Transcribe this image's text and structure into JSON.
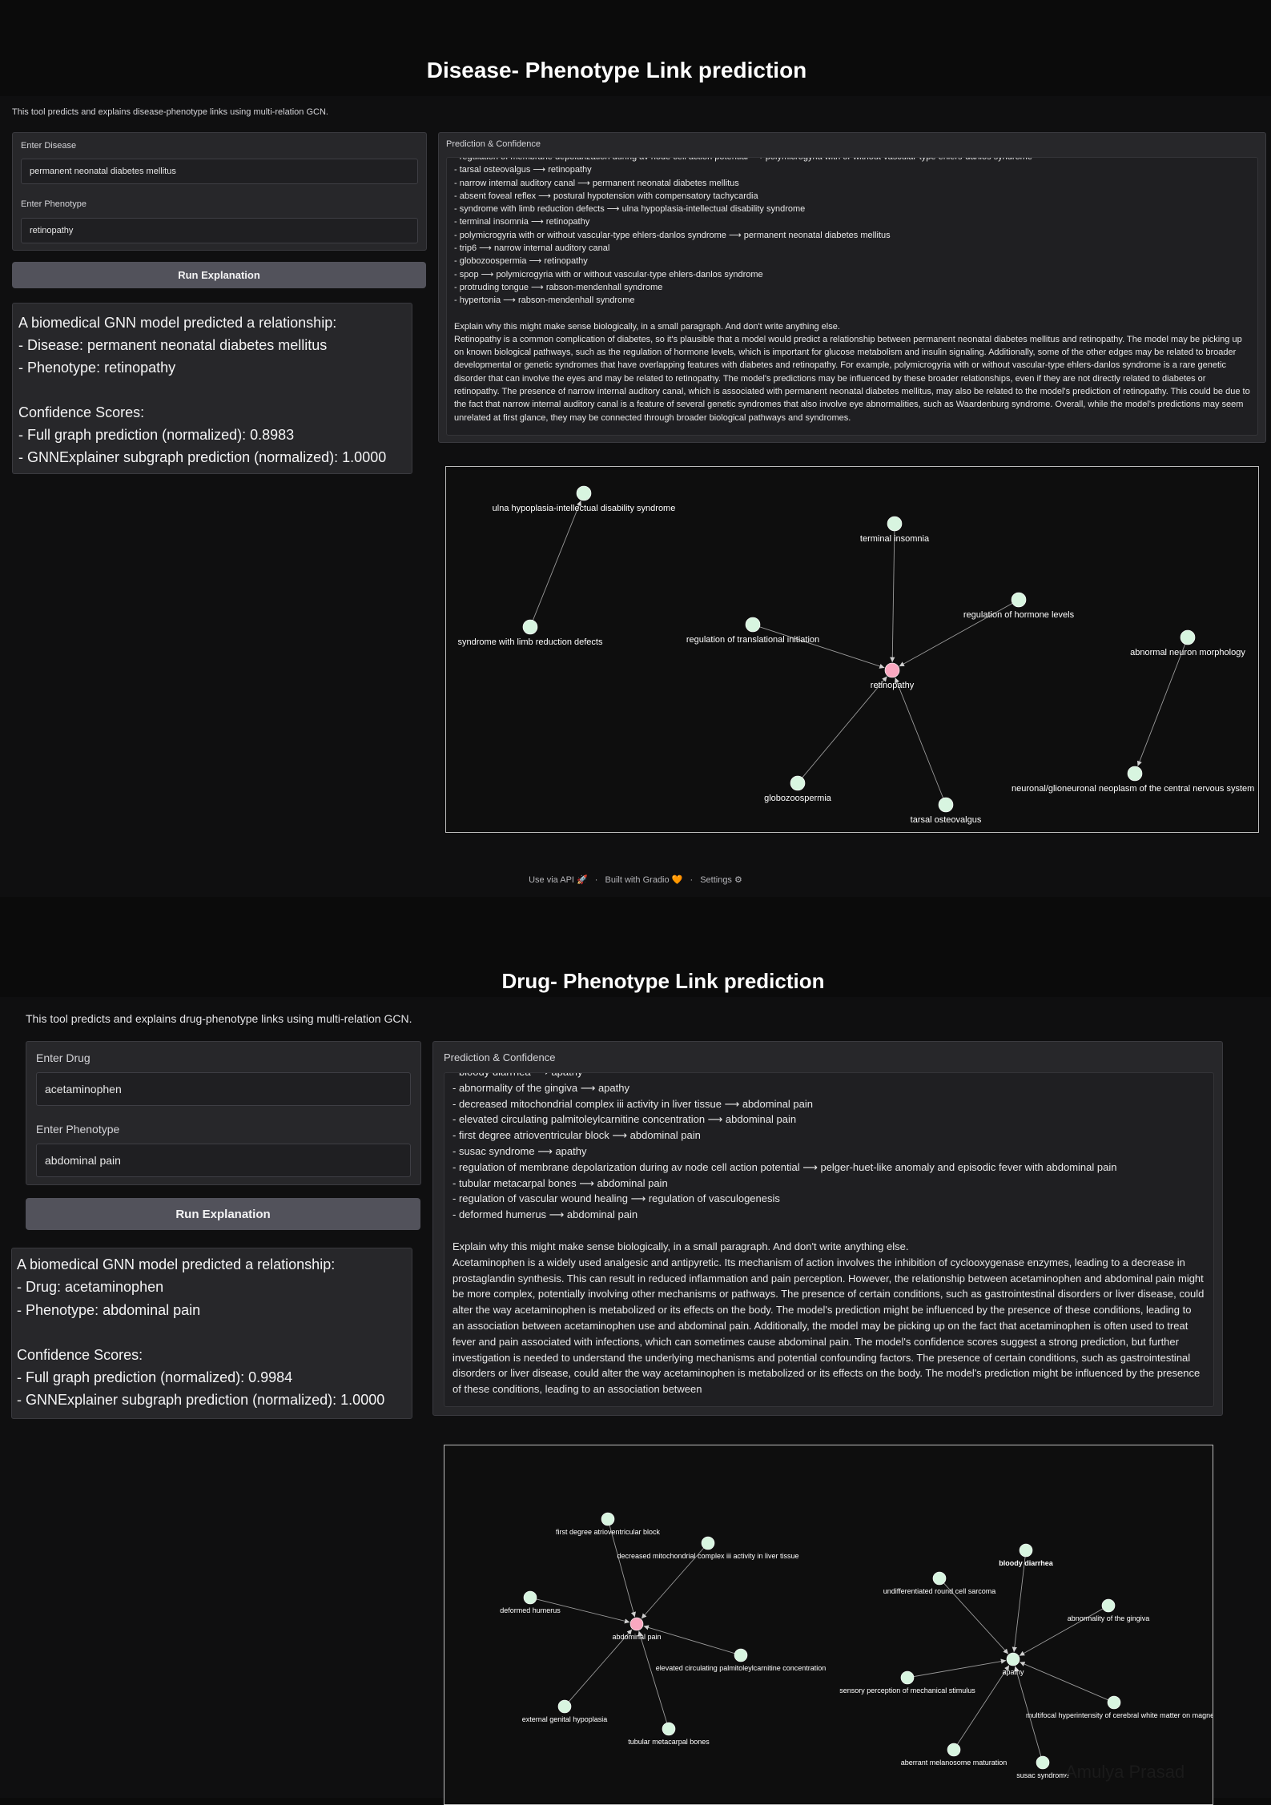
{
  "app1": {
    "title": "Disease- Phenotype Link prediction",
    "description": "This tool predicts and explains disease-phenotype links using multi-relation GCN.",
    "field1_label": "Enter Disease",
    "field1_value": "permanent neonatal diabetes mellitus",
    "field2_label": "Enter Phenotype",
    "field2_value": "retinopathy",
    "button_label": "Run Explanation",
    "result_lines": [
      "A biomedical GNN model predicted a relationship:",
      "- Disease: permanent neonatal diabetes mellitus",
      "- Phenotype: retinopathy",
      "",
      "Confidence Scores:",
      "- Full graph prediction (normalized): 0.8983",
      "- GNNExplainer subgraph prediction (normalized): 1.0000"
    ],
    "prediction_label": "Prediction & Confidence",
    "edges": [
      "- regulation of membrane depolarization during av node cell action potential ⟶ polymicrogyria with or without vascular-type ehlers-danlos syndrome",
      "- tarsal osteovalgus ⟶ retinopathy",
      "- narrow internal auditory canal ⟶ permanent neonatal diabetes mellitus",
      "- absent foveal reflex ⟶ postural hypotension with compensatory tachycardia",
      "- syndrome with limb reduction defects ⟶ ulna hypoplasia-intellectual disability syndrome",
      "- terminal insomnia ⟶ retinopathy",
      "- polymicrogyria with or without vascular-type ehlers-danlos syndrome ⟶ permanent neonatal diabetes mellitus",
      "- trip6 ⟶ narrow internal auditory canal",
      "- globozoospermia ⟶ retinopathy",
      "- spop ⟶ polymicrogyria with or without vascular-type ehlers-danlos syndrome",
      "- protruding tongue ⟶ rabson-mendenhall syndrome",
      "- hypertonia ⟶ rabson-mendenhall syndrome"
    ],
    "prompt": "Explain why this might make sense biologically, in a small paragraph. And don't write anything else.",
    "explanation": "Retinopathy is a common complication of diabetes, so it's plausible that a model would predict a relationship between permanent neonatal diabetes mellitus and retinopathy. The model may be picking up on known biological pathways, such as the regulation of hormone levels, which is important for glucose metabolism and insulin signaling. Additionally, some of the other edges may be related to broader developmental or genetic syndromes that have overlapping features with diabetes and retinopathy. For example, polymicrogyria with or without vascular-type ehlers-danlos syndrome is a rare genetic disorder that can involve the eyes and may be related to retinopathy. The model's predictions may be influenced by these broader relationships, even if they are not directly related to diabetes or retinopathy.  The presence of narrow internal auditory canal, which is associated with permanent neonatal diabetes mellitus, may also be related to the model's prediction of retinopathy. This could be due to the fact that narrow internal auditory canal is a feature of several genetic syndromes that also involve eye abnormalities, such as Waardenburg syndrome. Overall, while the model's predictions may seem unrelated at first glance, they may be connected through broader biological pathways and syndromes.",
    "graph_labels": {
      "ulna": "ulna hypoplasia-intellectual disability syndrome",
      "limb": "syndrome with limb reduction defects",
      "terminal": "terminal insomnia",
      "hormone": "regulation of hormone levels",
      "transl": "regulation of translational initiation",
      "retino": "retinopathy",
      "neuron": "abnormal neuron morphology",
      "neoplasm": "neuronal/glioneuronal neoplasm of the central nervous system",
      "globo": "globozoospermia",
      "tarsal": "tarsal osteovalgus"
    },
    "footer": {
      "api": "Use via API",
      "built": "Built with Gradio",
      "settings": "Settings",
      "sep": "·"
    }
  },
  "app2": {
    "title": "Drug- Phenotype Link prediction",
    "description": "This tool predicts and explains drug-phenotype links using multi-relation GCN.",
    "field1_label": "Enter Drug",
    "field1_value": "acetaminophen",
    "field2_label": "Enter Phenotype",
    "field2_value": "abdominal pain",
    "button_label": "Run Explanation",
    "result_lines": [
      "A biomedical GNN model predicted a relationship:",
      "- Drug: acetaminophen",
      "- Phenotype: abdominal pain",
      "",
      "Confidence Scores:",
      "- Full graph prediction (normalized): 0.9984",
      "- GNNExplainer subgraph prediction (normalized): 1.0000"
    ],
    "prediction_label": "Prediction & Confidence",
    "edges": [
      "- bloody diarrhea ⟶ apathy",
      "- abnormality of the gingiva ⟶ apathy",
      "- decreased mitochondrial complex iii activity in liver tissue ⟶ abdominal pain",
      "- elevated circulating palmitoleylcarnitine concentration ⟶ abdominal pain",
      "- first degree atrioventricular block ⟶ abdominal pain",
      "- susac syndrome ⟶ apathy",
      "- regulation of membrane depolarization during av node cell action potential ⟶ pelger-huet-like anomaly and episodic fever with abdominal pain",
      "- tubular metacarpal bones ⟶ abdominal pain",
      "- regulation of vascular wound healing ⟶ regulation of vasculogenesis",
      "- deformed humerus ⟶ abdominal pain"
    ],
    "prompt": "Explain why this might make sense biologically, in a small paragraph. And don't write anything else.",
    "explanation": "Acetaminophen is a widely used analgesic and antipyretic. Its mechanism of action involves the inhibition of cyclooxygenase enzymes, leading to a decrease in prostaglandin synthesis. This can result in reduced inflammation and pain perception. However, the relationship between acetaminophen and abdominal pain might be more complex, potentially involving other mechanisms or pathways. The presence of certain conditions, such as gastrointestinal disorders or liver disease, could alter the way acetaminophen is metabolized or its effects on the body. The model's prediction might be influenced by the presence of these conditions, leading to an association between acetaminophen use and abdominal pain. Additionally, the model may be picking up on the fact that acetaminophen is often used to treat fever and pain associated with infections, which can sometimes cause abdominal pain. The model's confidence scores suggest a strong prediction, but further investigation is needed to understand the underlying mechanisms and potential confounding factors.  The presence of certain conditions, such as gastrointestinal disorders or liver disease, could alter the way acetaminophen is metabolized or its effects on the body. The model's prediction might be influenced by the presence of these conditions, leading to an association between",
    "graph_labels": {
      "firstdeg": "first degree atrioventricular block",
      "mito": "decreased mitochondrial complex iii activity in liver tissue",
      "humerus": "deformed humerus",
      "abdominal": "abdominal pain",
      "palmit": "elevated circulating palmitoleylcarnitine concentration",
      "genital": "external genital hypoplasia",
      "tubular": "tubular metacarpal bones",
      "bloody": "bloody diarrhea",
      "sarcoma": "undifferentiated round cell sarcoma",
      "gingiva": "abnormality of the gingiva",
      "sensory": "sensory perception of mechanical stimulus",
      "apathy": "apathy",
      "multifocal": "multifocal hyperintensity of cerebral white matter on magnetic resonance imaging",
      "melano": "aberrant melanosome maturation",
      "susac": "susac syndrome"
    }
  },
  "watermark": "Amulya Prasad",
  "colors": {
    "target_node": "#f9a8c0",
    "other_node": "#d8f5e0",
    "edge": "#9a9a9a"
  }
}
